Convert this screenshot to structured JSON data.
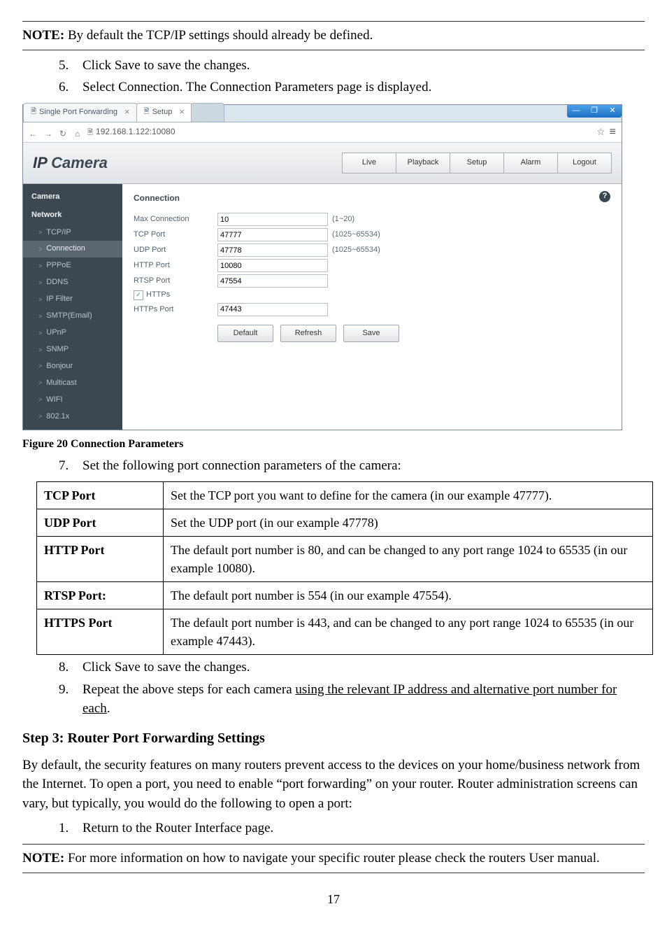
{
  "note1": "NOTE:",
  "note1_body": " By default the TCP/IP settings should already be defined.",
  "steps_a": [
    {
      "n": "5.",
      "t": "Click Save to save the changes."
    },
    {
      "n": "6.",
      "t": "Select Connection. The Connection Parameters page is displayed."
    }
  ],
  "browser": {
    "tabs": [
      {
        "title": "Single Port Forwarding"
      },
      {
        "title": "Setup"
      }
    ],
    "url": "192.168.1.122:10080"
  },
  "camera_ui": {
    "logo_pre": "IP ",
    "logo_main": "Camera",
    "nav": [
      "Live",
      "Playback",
      "Setup",
      "Alarm",
      "Logout"
    ],
    "sidebar": {
      "section1": "Camera",
      "section2": "Network",
      "items": [
        "TCP/IP",
        "Connection",
        "PPPoE",
        "DDNS",
        "IP Filter",
        "SMTP(Email)",
        "UPnP",
        "SNMP",
        "Bonjour",
        "Multicast",
        "WIFI",
        "802.1x"
      ]
    },
    "panel_title": "Connection",
    "fields": [
      {
        "label": "Max Connection",
        "value": "10",
        "hint": "(1~20)"
      },
      {
        "label": "TCP Port",
        "value": "47777",
        "hint": "(1025~65534)"
      },
      {
        "label": "UDP Port",
        "value": "47778",
        "hint": "(1025~65534)"
      },
      {
        "label": "HTTP Port",
        "value": "10080",
        "hint": ""
      },
      {
        "label": "RTSP Port",
        "value": "47554",
        "hint": ""
      }
    ],
    "https_label": "HTTPs",
    "https_port_label": "HTTPs Port",
    "https_port_value": "47443",
    "buttons": [
      "Default",
      "Refresh",
      "Save"
    ]
  },
  "fig_caption": "Figure 20 Connection Parameters",
  "step7": {
    "n": "7.",
    "t": "Set the following port connection parameters of the camera:"
  },
  "ports": [
    {
      "k": "TCP Port",
      "v": "Set the TCP port you want to define for the camera (in our example 47777)."
    },
    {
      "k": "UDP Port",
      "v": "Set the UDP port (in our example 47778)"
    },
    {
      "k": "HTTP Port",
      "v": "The default port number is 80, and can be changed to any port range 1024 to 65535 (in our example 10080)."
    },
    {
      "k": "RTSP Port:",
      "v": "The default port number is 554 (in our example 47554)."
    },
    {
      "k": "HTTPS Port",
      "v": "The default port number is 443, and can be changed to any port range 1024 to 65535 (in our example 47443)."
    }
  ],
  "steps_b": [
    {
      "n": "8.",
      "t": "Click Save to save the changes."
    },
    {
      "n": "9.",
      "t_pre": "Repeat the above steps for each camera ",
      "t_u": "using the relevant IP address and alternative port number for each",
      "t_post": "."
    }
  ],
  "step3_heading": "Step 3: Router Port Forwarding Settings",
  "para": "By default, the security features on many routers prevent access to the devices on your home/business network from the Internet. To open a port, you need to enable “port forwarding” on your router. Router administration screens can vary, but typically, you would do the following to open a port:",
  "steps_c": [
    {
      "n": "1.",
      "t": "Return to the Router Interface page."
    }
  ],
  "note2": "NOTE:",
  "note2_body": " For more information on how to navigate your specific router please check the routers User manual.",
  "page": "17"
}
